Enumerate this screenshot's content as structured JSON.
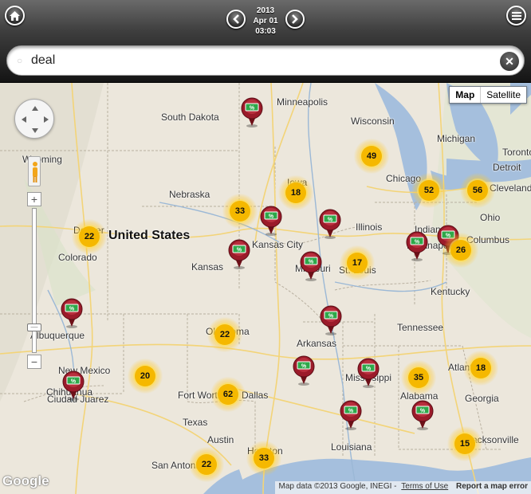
{
  "toolbar": {
    "home_icon": "home-icon",
    "menu_icon": "menu-icon",
    "prev_icon": "chevron-left-icon",
    "next_icon": "chevron-right-icon",
    "date_year": "2013",
    "date_day": "Apr 01",
    "time": "03:03"
  },
  "search": {
    "value": "deal",
    "clear_icon": "close-icon"
  },
  "map": {
    "type_map_label": "Map",
    "type_satellite_label": "Satellite",
    "country_label": "United States",
    "logo_text": "Google",
    "attribution": "Map data ©2013 Google, INEGI -",
    "terms_link": "Terms of Use",
    "report_link": "Report a map error",
    "places": [
      {
        "name": "South Dakota"
      },
      {
        "name": "Minneapolis"
      },
      {
        "name": "Wisconsin"
      },
      {
        "name": "Michigan"
      },
      {
        "name": "Wyoming"
      },
      {
        "name": "Iowa"
      },
      {
        "name": "Nebraska"
      },
      {
        "name": "Chicago"
      },
      {
        "name": "Detroit"
      },
      {
        "name": "Cleveland"
      },
      {
        "name": "Toronto"
      },
      {
        "name": "Denver"
      },
      {
        "name": "Illinois"
      },
      {
        "name": "Indiana"
      },
      {
        "name": "Ohio"
      },
      {
        "name": "Colorado"
      },
      {
        "name": "Kansas City"
      },
      {
        "name": "Indianapolis"
      },
      {
        "name": "Columbus"
      },
      {
        "name": "Kansas"
      },
      {
        "name": "Missouri"
      },
      {
        "name": "St. Louis"
      },
      {
        "name": "Kentucky"
      },
      {
        "name": "Tennessee"
      },
      {
        "name": "Albuquerque"
      },
      {
        "name": "Oklahoma"
      },
      {
        "name": "Arkansas"
      },
      {
        "name": "New Mexico"
      },
      {
        "name": "Atlanta"
      },
      {
        "name": "Mississippi"
      },
      {
        "name": "Alabama"
      },
      {
        "name": "Georgia"
      },
      {
        "name": "Fort Worth"
      },
      {
        "name": "Dallas"
      },
      {
        "name": "Texas"
      },
      {
        "name": "Ciudad Juarez"
      },
      {
        "name": "Louisiana"
      },
      {
        "name": "Austin"
      },
      {
        "name": "Jacksonville"
      },
      {
        "name": "Houston"
      },
      {
        "name": "San Antonio"
      },
      {
        "name": "Chihuahua"
      }
    ],
    "clusters": [
      {
        "count": "49"
      },
      {
        "count": "18"
      },
      {
        "count": "52"
      },
      {
        "count": "56"
      },
      {
        "count": "33"
      },
      {
        "count": "22"
      },
      {
        "count": "26"
      },
      {
        "count": "17"
      },
      {
        "count": "22"
      },
      {
        "count": "20"
      },
      {
        "count": "62"
      },
      {
        "count": "35"
      },
      {
        "count": "18"
      },
      {
        "count": "15"
      },
      {
        "count": "22"
      },
      {
        "count": "33"
      }
    ],
    "pin_icon": "deal-marker-icon",
    "pin_glyph": "%"
  },
  "colors": {
    "land": "#ece7dc",
    "water": "#a5bfdd",
    "cluster": "#f5b800",
    "marker": "#9b1b2a"
  }
}
